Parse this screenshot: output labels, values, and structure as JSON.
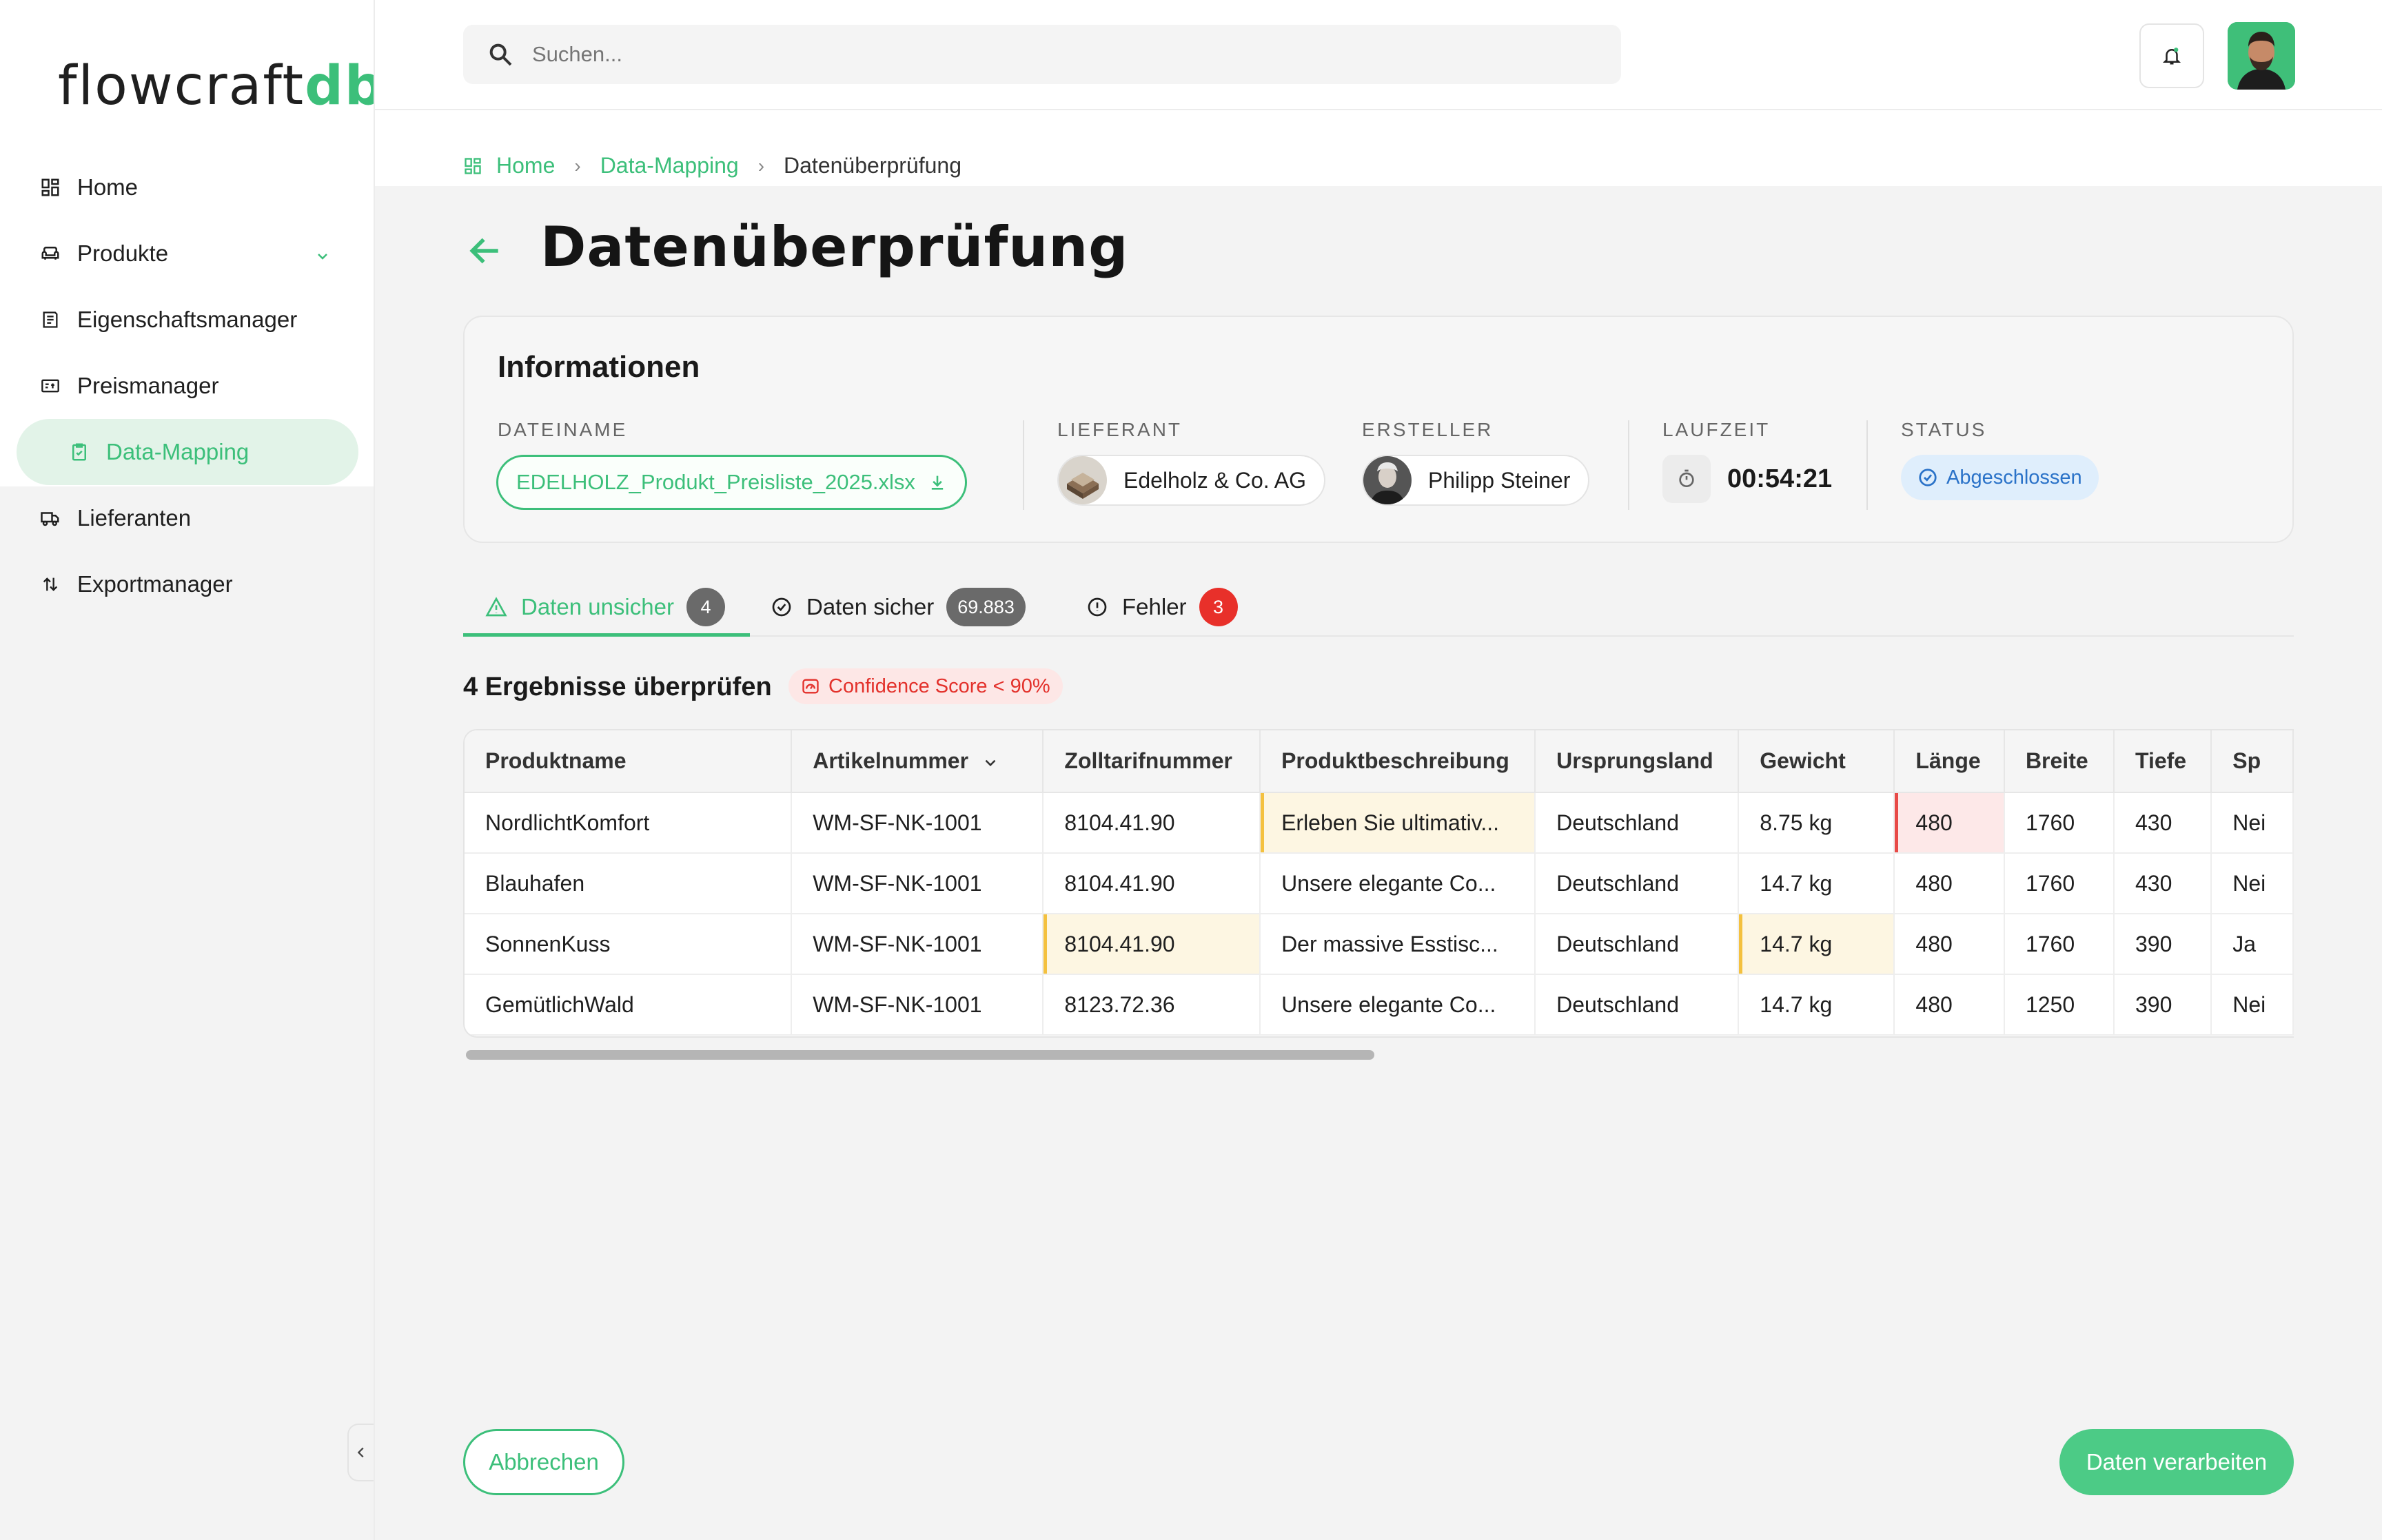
{
  "app": {
    "logo_part1": "flowcraft",
    "logo_part2": "db",
    "brand_color": "#3cbf7a"
  },
  "sidebar": {
    "items": [
      {
        "label": "Home",
        "icon": "dashboard-icon"
      },
      {
        "label": "Produkte",
        "icon": "sofa-icon"
      },
      {
        "label": "Eigenschaftsmanager",
        "icon": "properties-icon"
      },
      {
        "label": "Preismanager",
        "icon": "price-tag-icon"
      },
      {
        "label": "Data-Mapping",
        "icon": "clipboard-check-icon",
        "active": true
      },
      {
        "label": "Lieferanten",
        "icon": "truck-icon"
      },
      {
        "label": "Exportmanager",
        "icon": "arrows-updown-icon"
      }
    ]
  },
  "header": {
    "search_placeholder": "Suchen..."
  },
  "breadcrumb": {
    "home": "Home",
    "parent": "Data-Mapping",
    "current": "Datenüberprüfung"
  },
  "page": {
    "title": "Datenüberprüfung"
  },
  "info": {
    "title": "Informationen",
    "filename_label": "DATEINAME",
    "filename": "EDELHOLZ_Produkt_Preisliste_2025.xlsx",
    "supplier_label": "LIEFERANT",
    "supplier": "Edelholz & Co. AG",
    "creator_label": "ERSTELLER",
    "creator": "Philipp Steiner",
    "runtime_label": "LAUFZEIT",
    "runtime": "00:54:21",
    "status_label": "STATUS",
    "status": "Abgeschlossen",
    "status_color": "#2a72c8"
  },
  "tabs": [
    {
      "label": "Daten unsicher",
      "count": "4",
      "active": true
    },
    {
      "label": "Daten sicher",
      "count": "69.883"
    },
    {
      "label": "Fehler",
      "count": "3"
    }
  ],
  "results": {
    "title": "4 Ergebnisse überprüfen",
    "badge": "Confidence Score < 90%"
  },
  "table": {
    "columns": [
      "Produktname",
      "Artikelnummer",
      "Zolltarifnummer",
      "Produktbeschreibung",
      "Ursprungsland",
      "Gewicht",
      "Länge",
      "Breite",
      "Tiefe",
      "Sp"
    ],
    "rows": [
      [
        "NordlichtKomfort",
        "WM-SF-NK-1001",
        "8104.41.90",
        "Erleben Sie ultimativ...",
        "Deutschland",
        "8.75 kg",
        "480",
        "1760",
        "430",
        "Nei"
      ],
      [
        "Blauhafen",
        "WM-SF-NK-1001",
        "8104.41.90",
        "Unsere elegante Co...",
        "Deutschland",
        "14.7 kg",
        "480",
        "1760",
        "430",
        "Nei"
      ],
      [
        "SonnenKuss",
        "WM-SF-NK-1001",
        "8104.41.90",
        "Der massive Esstisc...",
        "Deutschland",
        "14.7 kg",
        "480",
        "1760",
        "390",
        "Ja"
      ],
      [
        "GemütlichWald",
        "WM-SF-NK-1001",
        "8123.72.36",
        "Unsere elegante Co...",
        "Deutschland",
        "14.7 kg",
        "480",
        "1250",
        "390",
        "Nei"
      ]
    ],
    "highlights": {
      "warning_color": "#f4c13f",
      "error_color": "#e84a47"
    }
  },
  "footer": {
    "cancel": "Abbrechen",
    "process": "Daten verarbeiten"
  }
}
